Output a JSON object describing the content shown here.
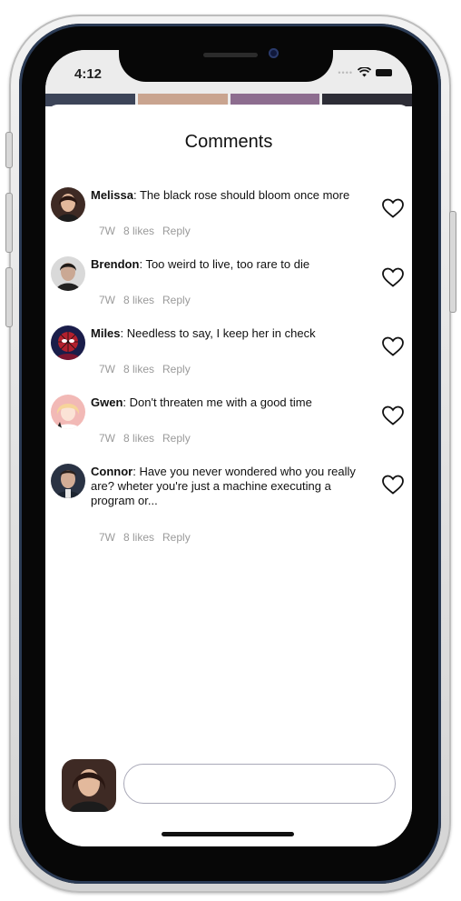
{
  "status_bar": {
    "time": "4:12",
    "icons": [
      "cellular-dots-icon",
      "wifi-icon",
      "battery-icon"
    ]
  },
  "sheet": {
    "title": "Comments"
  },
  "comments": [
    {
      "author": "Melissa",
      "text": ": The black rose should bloom once more",
      "age": "7W",
      "likes": "8 likes",
      "reply": "Reply",
      "liked": false
    },
    {
      "author": "Brendon",
      "text": ": Too weird to live, too rare to die",
      "age": "7W",
      "likes": "8 likes",
      "reply": "Reply",
      "liked": false
    },
    {
      "author": "Miles",
      "text": ": Needless to say, I keep her in check",
      "age": "7W",
      "likes": "8 likes",
      "reply": "Reply",
      "liked": false
    },
    {
      "author": "Gwen",
      "text": ": Don't threaten me with a good time",
      "age": "7W",
      "likes": "8 likes",
      "reply": "Reply",
      "liked": false
    },
    {
      "author": "Connor",
      "text": ": Have you never wondered who you really are? wheter you're just a machine executing a program or...",
      "age": "7W",
      "likes": "8 likes",
      "reply": "Reply",
      "liked": false
    }
  ],
  "composer": {
    "value": "",
    "placeholder": ""
  },
  "colors": {
    "meta_text": "#9a9a9a",
    "input_border": "#a9a9b8",
    "device_frame": "#d4d4d4",
    "bezel": "#070707"
  }
}
